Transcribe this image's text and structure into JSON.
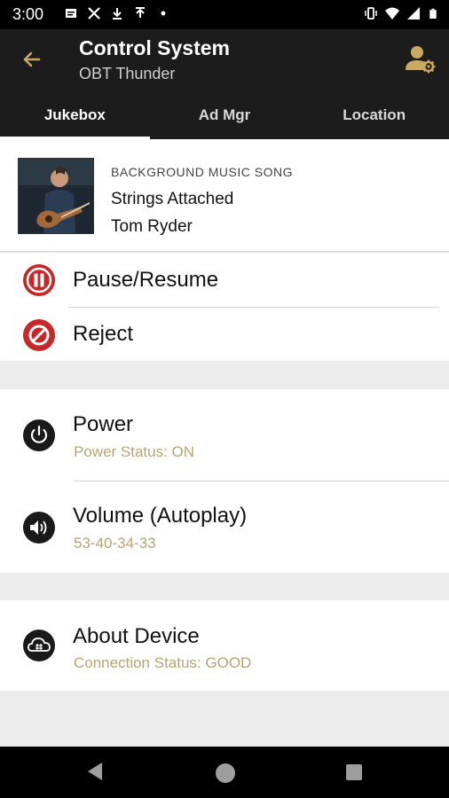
{
  "status_bar": {
    "time": "3:00",
    "left_icons": [
      "message-icon",
      "tools-icon",
      "download-icon",
      "upload-icon",
      "dot-icon"
    ],
    "right_icons": [
      "vibrate-icon",
      "wifi-icon",
      "signal-icon",
      "battery-icon"
    ]
  },
  "header": {
    "title": "Control System",
    "subtitle": "OBT Thunder",
    "accent_color": "#c9a862"
  },
  "tabs": [
    {
      "label": "Jukebox",
      "active": true
    },
    {
      "label": "Ad Mgr",
      "active": false
    },
    {
      "label": "Location",
      "active": false
    }
  ],
  "now_playing": {
    "label": "BACKGROUND MUSIC SONG",
    "song": "Strings Attached",
    "artist": "Tom Ryder"
  },
  "actions": {
    "pause_label": "Pause/Resume",
    "reject_label": "Reject",
    "action_color": "#c62828"
  },
  "controls": {
    "power": {
      "title": "Power",
      "status": "Power Status: ON"
    },
    "volume": {
      "title": "Volume (Autoplay)",
      "status": "53-40-34-33"
    }
  },
  "device": {
    "title": "About Device",
    "status": "Connection Status: GOOD"
  }
}
